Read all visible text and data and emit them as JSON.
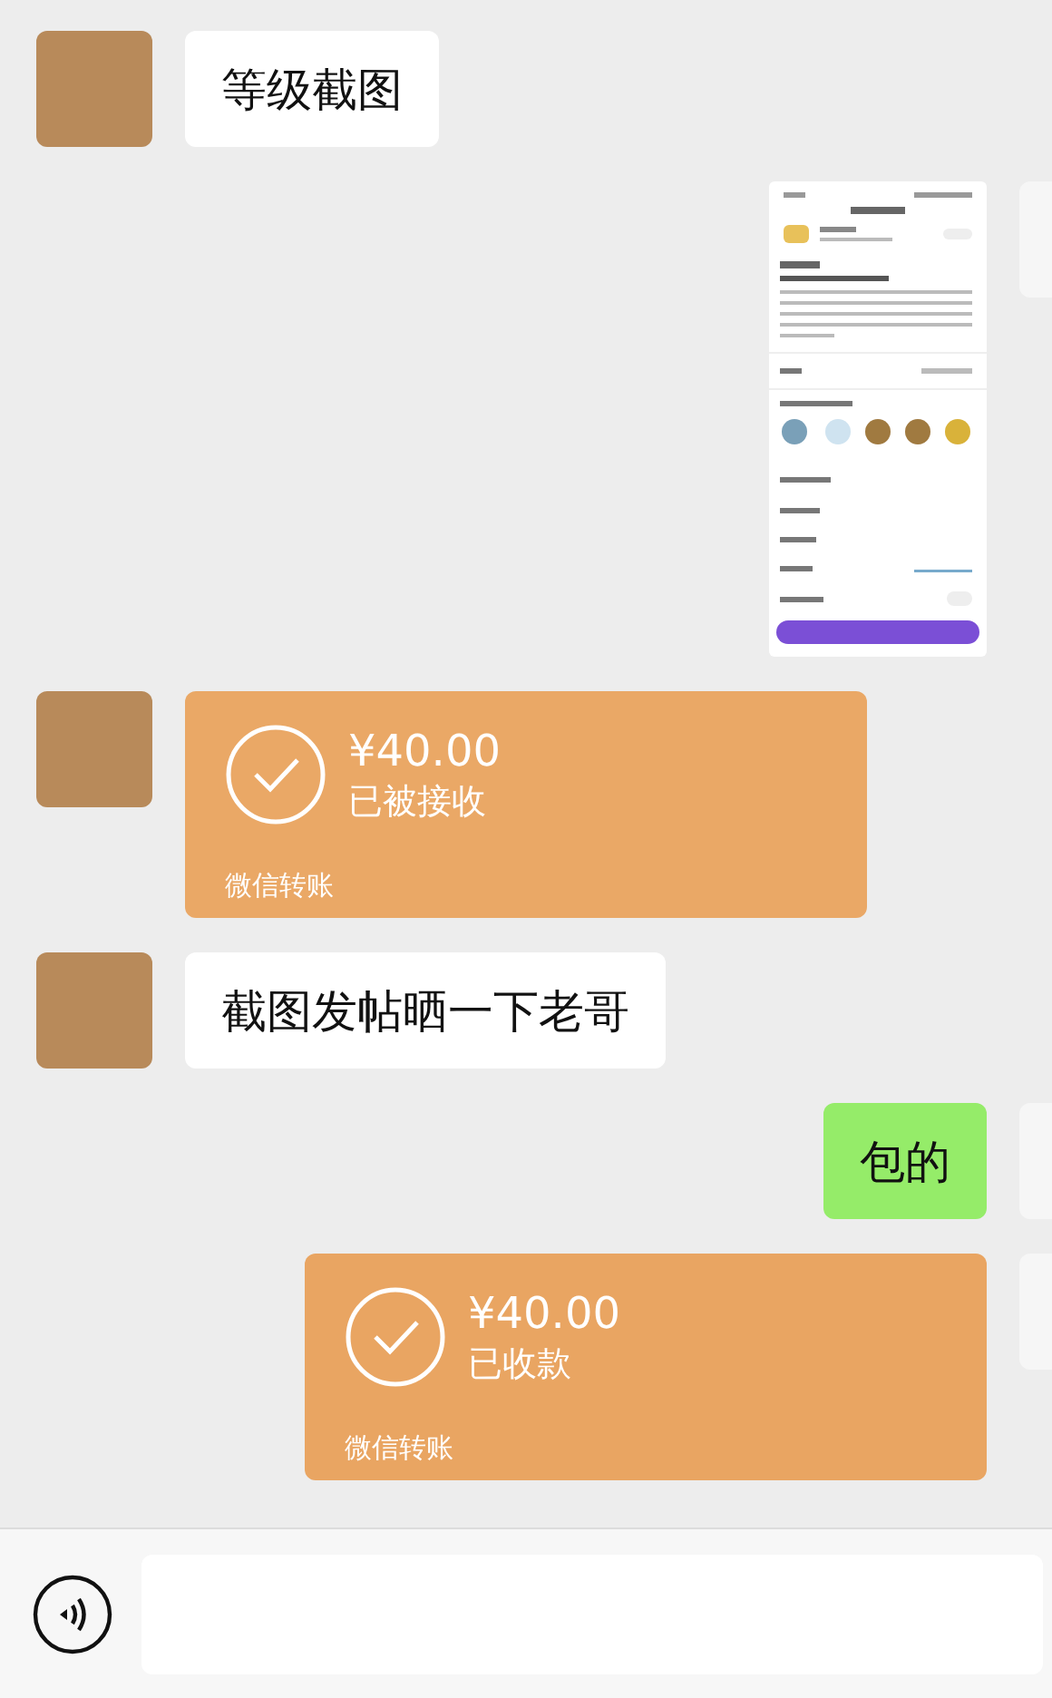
{
  "messages": [
    {
      "kind": "text",
      "outgoing": false,
      "text": "等级截图"
    },
    {
      "kind": "image",
      "outgoing": true
    },
    {
      "kind": "transfer",
      "outgoing": false,
      "amount": "¥40.00",
      "status": "已被接收",
      "label": "微信转账"
    },
    {
      "kind": "text",
      "outgoing": false,
      "text": "截图发帖晒一下老哥"
    },
    {
      "kind": "text",
      "outgoing": true,
      "text": "包的"
    },
    {
      "kind": "transfer",
      "outgoing": true,
      "amount": "¥40.00",
      "status": "已收款",
      "label": "微信转账"
    }
  ]
}
